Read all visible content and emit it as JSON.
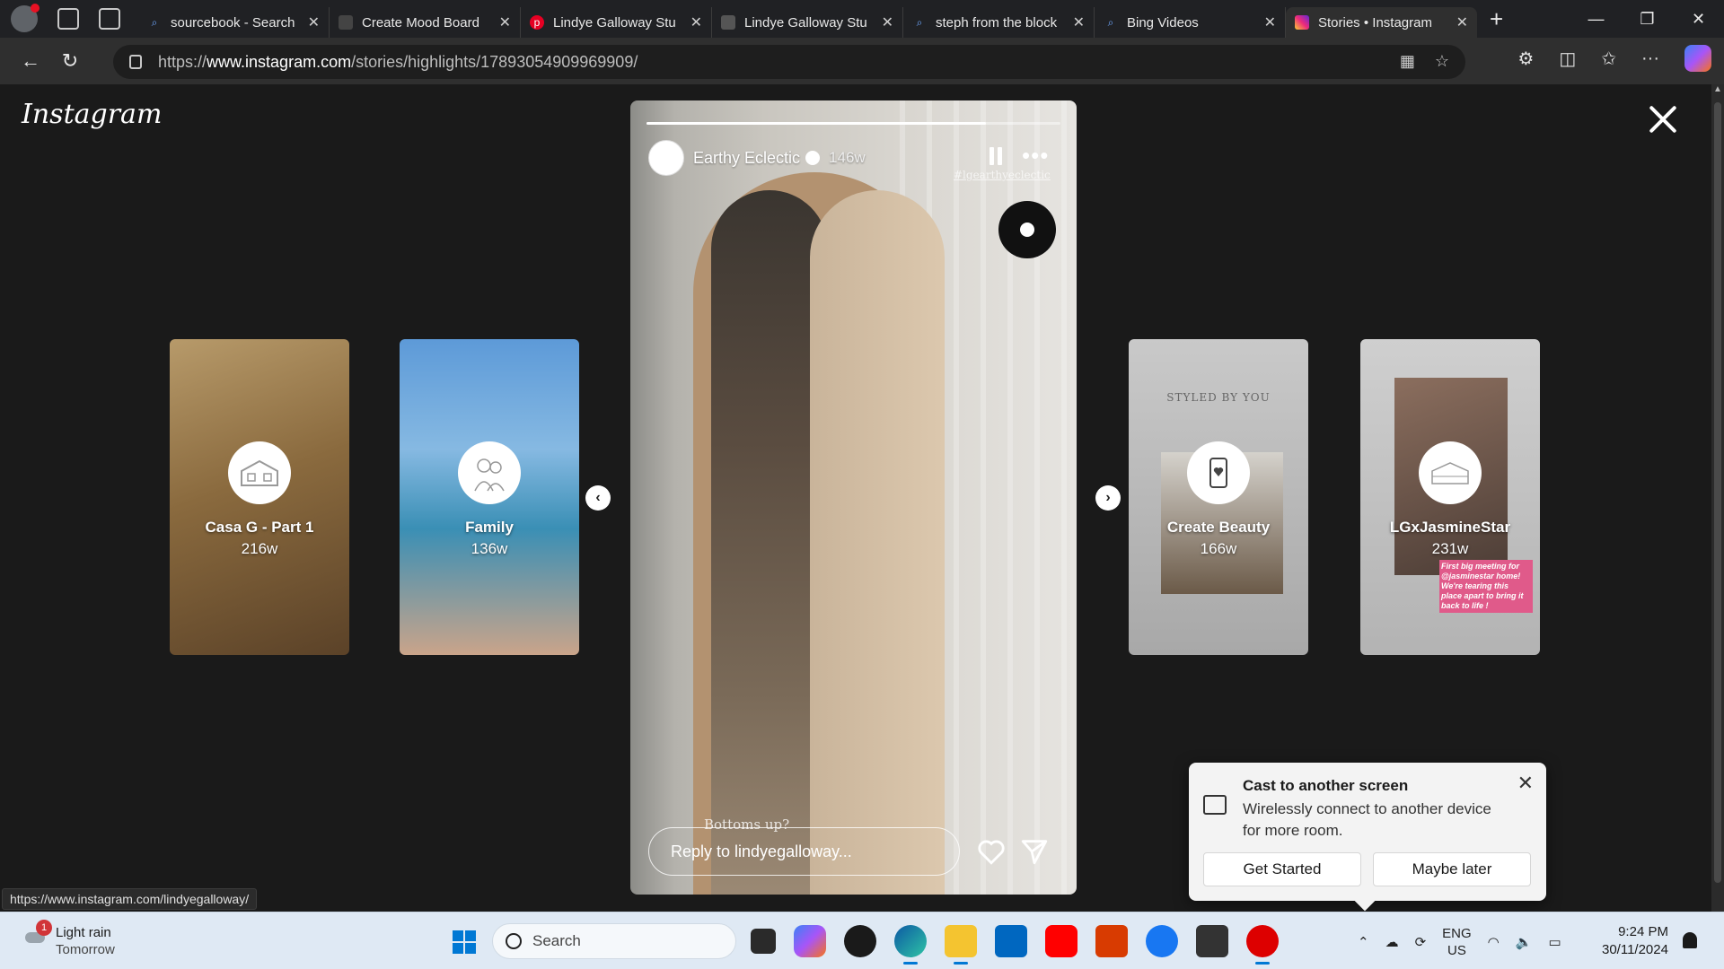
{
  "browser": {
    "tabs": [
      {
        "title": "sourcebook - Search",
        "icon": "search-icon"
      },
      {
        "title": "Create Mood Board",
        "icon": "moodboard-icon"
      },
      {
        "title": "Lindye Galloway Stu",
        "icon": "pinterest-icon"
      },
      {
        "title": "Lindye Galloway Stu",
        "icon": "site-icon"
      },
      {
        "title": "steph from the block",
        "icon": "search-icon"
      },
      {
        "title": "Bing Videos",
        "icon": "search-icon"
      },
      {
        "title": "Stories • Instagram",
        "icon": "instagram-icon",
        "active": true
      }
    ],
    "url_prefix": "https://",
    "url_domain": "www.instagram.com",
    "url_path": "/stories/highlights/17893054909969909/"
  },
  "instagram": {
    "logo": "Instagram",
    "story": {
      "account": "Earthy Eclectic",
      "age": "146w",
      "handle_overlay": "#lgearthyeclectic",
      "caption_overlay": "Bottoms up? ",
      "reply_placeholder": "Reply to lindyegalloway..."
    },
    "highlights": [
      {
        "name": "Casa G - Part 1",
        "age": "216w"
      },
      {
        "name": "Family",
        "age": "136w"
      },
      {
        "name": "Create Beauty",
        "age": "166w",
        "tagline": "STYLED BY YOU"
      },
      {
        "name": "LGxJasmineStar",
        "age": "231w",
        "sticker": "First big meeting for @jasminestar home! We're tearing this place apart to bring it back to life !"
      }
    ]
  },
  "status_url": "https://www.instagram.com/lindyegalloway/",
  "cast_popup": {
    "title": "Cast to another screen",
    "description": "Wirelessly connect to another device for more room.",
    "primary_button": "Get Started",
    "secondary_button": "Maybe later"
  },
  "taskbar": {
    "weather": "Light rain",
    "weather_when": "Tomorrow",
    "weather_badge": "1",
    "search_placeholder": "Search",
    "lang_line1": "ENG",
    "lang_line2": "US",
    "time": "9:24 PM",
    "date": "30/11/2024"
  },
  "colors": {
    "edge_active_accent": "#0078d4",
    "instagram_bg": "#1a1a1a"
  }
}
